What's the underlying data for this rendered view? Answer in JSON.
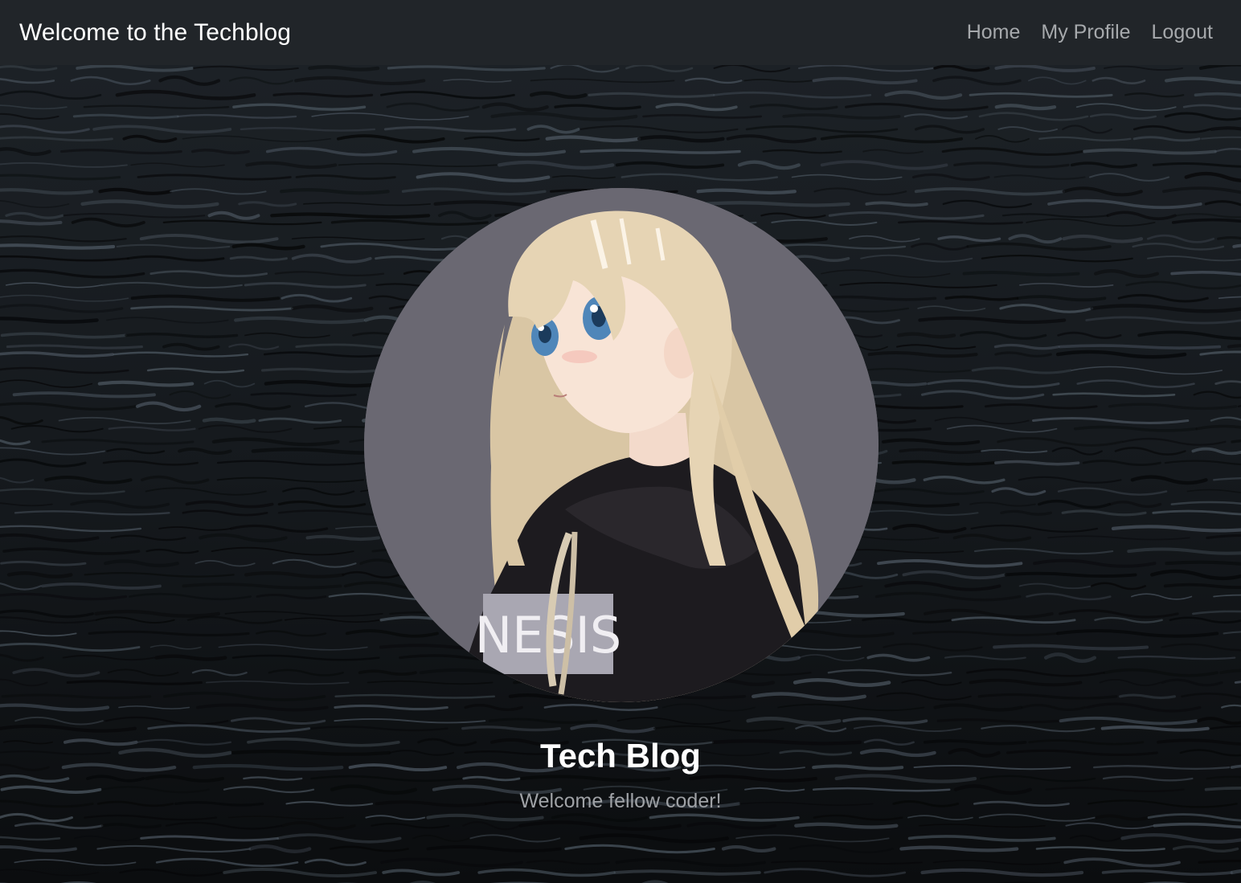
{
  "navbar": {
    "brand": "Welcome to the Techblog",
    "links": [
      {
        "label": "Home"
      },
      {
        "label": "My Profile"
      },
      {
        "label": "Logout"
      }
    ]
  },
  "hero": {
    "background": "dark-water-waves",
    "avatar": {
      "subject": "anime-girl-black-hoodie",
      "hoodie_text": "NESIS"
    },
    "title": "Tech Blog",
    "subtitle": "Welcome fellow coder!"
  },
  "colors": {
    "navbar_bg": "#212529",
    "brand_text": "#ffffff",
    "nav_link": "#a6a9ac",
    "title": "#ffffff",
    "subtitle": "#9fa2a6",
    "avatar_bg": "#6a6872"
  }
}
